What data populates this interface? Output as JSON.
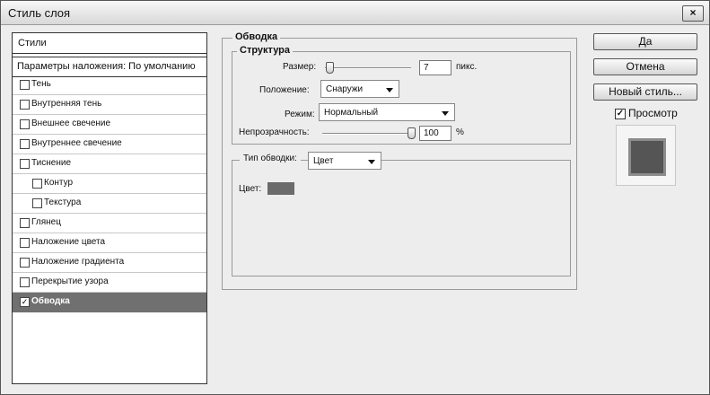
{
  "window": {
    "title": "Стиль слоя",
    "close_glyph": "×"
  },
  "styles_panel": {
    "header": "Стили",
    "blending": "Параметры наложения: По умолчанию",
    "items": [
      {
        "label": "Тень",
        "checked": false,
        "indent": false
      },
      {
        "label": "Внутренняя тень",
        "checked": false,
        "indent": false
      },
      {
        "label": "Внешнее свечение",
        "checked": false,
        "indent": false
      },
      {
        "label": "Внутреннее свечение",
        "checked": false,
        "indent": false
      },
      {
        "label": "Тиснение",
        "checked": false,
        "indent": false
      },
      {
        "label": "Контур",
        "checked": false,
        "indent": true
      },
      {
        "label": "Текстура",
        "checked": false,
        "indent": true
      },
      {
        "label": "Глянец",
        "checked": false,
        "indent": false
      },
      {
        "label": "Наложение цвета",
        "checked": false,
        "indent": false
      },
      {
        "label": "Наложение градиента",
        "checked": false,
        "indent": false
      },
      {
        "label": "Перекрытие узора",
        "checked": false,
        "indent": false
      },
      {
        "label": "Обводка",
        "checked": true,
        "indent": false,
        "selected": true
      }
    ],
    "checkmark": "✓"
  },
  "stroke": {
    "title": "Обводка",
    "structure": {
      "title": "Структура",
      "size_label": "Размер:",
      "size_value": "7",
      "size_unit": "пикс.",
      "position_label": "Положение:",
      "position_value": "Снаружи",
      "mode_label": "Режим:",
      "mode_value": "Нормальный",
      "opacity_label": "Непрозрачность:",
      "opacity_value": "100",
      "opacity_unit": "%",
      "opacity_percent": 100
    },
    "fill": {
      "type_label": "Тип обводки:",
      "type_value": "Цвет",
      "color_label": "Цвет:",
      "color_swatch": "#6b6b6b"
    }
  },
  "buttons": {
    "ok": "Да",
    "cancel": "Отмена",
    "new_style": "Новый стиль..."
  },
  "preview": {
    "label": "Просмотр",
    "checked": true,
    "checkmark": "✓"
  }
}
